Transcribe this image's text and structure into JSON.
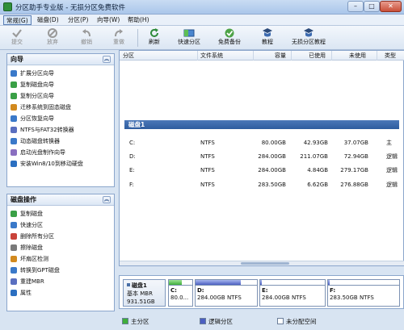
{
  "window": {
    "title": "分区助手专业版 - 无损分区免费软件",
    "minimize": "–",
    "maximize": "□",
    "close": "✕"
  },
  "menu": [
    "常规(G)",
    "磁盘(D)",
    "分区(P)",
    "向导(W)",
    "帮助(H)"
  ],
  "toolbar": {
    "buttons": [
      {
        "label": "提交",
        "icon": "submit-icon",
        "enabled": false
      },
      {
        "label": "放弃",
        "icon": "discard-icon",
        "enabled": false
      },
      {
        "label": "撤销",
        "icon": "undo-icon",
        "enabled": false
      },
      {
        "label": "重做",
        "icon": "redo-icon",
        "enabled": false
      },
      {
        "label": "刷新",
        "icon": "refresh-icon",
        "enabled": true
      },
      {
        "label": "快速分区",
        "icon": "quick-partition-icon",
        "enabled": true
      },
      {
        "label": "免费备份",
        "icon": "backup-icon",
        "enabled": true
      },
      {
        "label": "教程",
        "icon": "tutorial-icon",
        "enabled": true
      },
      {
        "label": "无损分区教程",
        "icon": "lossless-tutorial-icon",
        "enabled": true
      }
    ]
  },
  "wizard_panel": {
    "title": "向导",
    "collapse": "︽",
    "items": [
      {
        "label": "扩展分区向导",
        "icon": "extend-wizard-icon",
        "color": "#3a79c9"
      },
      {
        "label": "复制磁盘向导",
        "icon": "copy-disk-icon",
        "color": "#3aa046"
      },
      {
        "label": "复制分区向导",
        "icon": "copy-partition-icon",
        "color": "#3aa046"
      },
      {
        "label": "迁移系统到固态磁盘",
        "icon": "migrate-os-icon",
        "color": "#d28a1e"
      },
      {
        "label": "分区恢复向导",
        "icon": "partition-recovery-icon",
        "color": "#3a79c9"
      },
      {
        "label": "NTFS与FAT32转换器",
        "icon": "ntfs-fat32-icon",
        "color": "#5a6fc0"
      },
      {
        "label": "动态磁盘转换器",
        "icon": "dynamic-disk-icon",
        "color": "#3a79c9"
      },
      {
        "label": "启动光盘制作向导",
        "icon": "boot-cd-icon",
        "color": "#8a6fc0"
      },
      {
        "label": "安装Win8/10到移动硬盘",
        "icon": "win-to-go-icon",
        "color": "#2b6fc1"
      }
    ]
  },
  "disk_ops_panel": {
    "title": "磁盘操作",
    "collapse": "︽",
    "items": [
      {
        "label": "复制磁盘",
        "icon": "copy-disk-op-icon",
        "color": "#3aa046"
      },
      {
        "label": "快速分区",
        "icon": "quick-partition-op-icon",
        "color": "#3a79c9"
      },
      {
        "label": "删除所有分区",
        "icon": "delete-all-icon",
        "color": "#c9433a"
      },
      {
        "label": "擦除磁盘",
        "icon": "wipe-disk-icon",
        "color": "#7a7a7a"
      },
      {
        "label": "坏扇区检测",
        "icon": "bad-sector-icon",
        "color": "#d28a1e"
      },
      {
        "label": "转换到GPT磁盘",
        "icon": "convert-gpt-icon",
        "color": "#3a79c9"
      },
      {
        "label": "重建MBR",
        "icon": "rebuild-mbr-icon",
        "color": "#5a6fc0"
      },
      {
        "label": "属性",
        "icon": "properties-icon",
        "color": "#2b6fc1"
      }
    ]
  },
  "table": {
    "columns": [
      "分区",
      "文件系统",
      "容量",
      "已使用",
      "未使用",
      "类型"
    ],
    "disk_label": "磁盘1",
    "rows": [
      {
        "partition": "C:",
        "fs": "NTFS",
        "capacity": "80.00GB",
        "used": "42.93GB",
        "free": "37.07GB",
        "type": "主"
      },
      {
        "partition": "D:",
        "fs": "NTFS",
        "capacity": "284.00GB",
        "used": "211.07GB",
        "free": "72.94GB",
        "type": "逻辑"
      },
      {
        "partition": "E:",
        "fs": "NTFS",
        "capacity": "284.00GB",
        "used": "4.84GB",
        "free": "279.17GB",
        "type": "逻辑"
      },
      {
        "partition": "F:",
        "fs": "NTFS",
        "capacity": "283.50GB",
        "used": "6.62GB",
        "free": "276.88GB",
        "type": "逻辑"
      }
    ]
  },
  "disk_map": {
    "disk_name": "磁盘1",
    "disk_type": "基本 MBR",
    "disk_size": "931.51GB",
    "partitions": [
      {
        "name": "C:",
        "desc": "80.0...",
        "kind": "primary",
        "used_fraction": 0.54
      },
      {
        "name": "D:",
        "desc": "284.00GB NTFS",
        "kind": "logical",
        "used_fraction": 0.74
      },
      {
        "name": "E:",
        "desc": "284.00GB NTFS",
        "kind": "logical",
        "used_fraction": 0.02
      },
      {
        "name": "F:",
        "desc": "283.50GB NTFS",
        "kind": "logical",
        "used_fraction": 0.02
      }
    ]
  },
  "legend": [
    {
      "label": "主分区",
      "color": "#3fae3a"
    },
    {
      "label": "逻辑分区",
      "color": "#4b5fc1"
    },
    {
      "label": "未分配空间",
      "color": "#ffffff"
    }
  ]
}
